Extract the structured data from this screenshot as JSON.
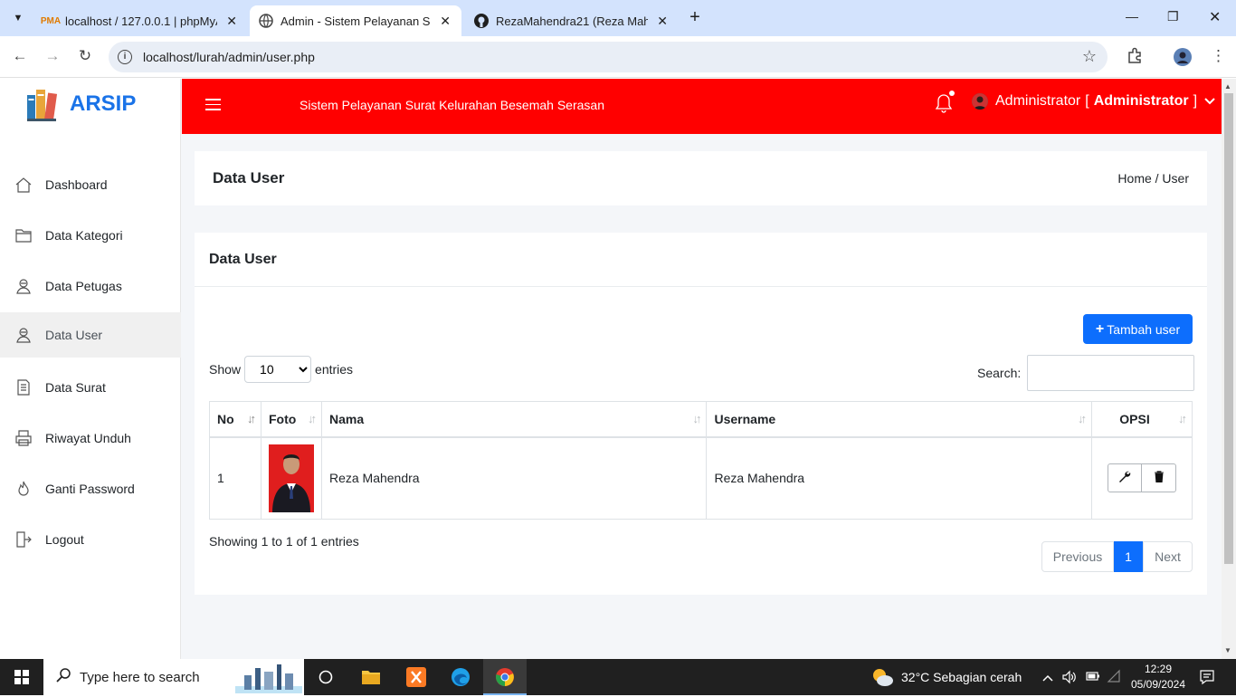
{
  "browser": {
    "tabs": [
      {
        "title": "localhost / 127.0.0.1 | phpMyAdmin",
        "favicon": "phpmyadmin-icon"
      },
      {
        "title": "Admin - Sistem Pelayanan Surat",
        "favicon": "globe-icon"
      },
      {
        "title": "RezaMahendra21 (Reza Mahendra)",
        "favicon": "github-icon"
      }
    ],
    "url": "localhost/lurah/admin/user.php"
  },
  "sidebar": {
    "brand": "ARSIP",
    "items": [
      {
        "label": "Dashboard",
        "icon": "home-icon"
      },
      {
        "label": "Data Kategori",
        "icon": "folder-icon"
      },
      {
        "label": "Data Petugas",
        "icon": "user-icon"
      },
      {
        "label": "Data User",
        "icon": "user-icon",
        "active": true
      },
      {
        "label": "Data Surat",
        "icon": "document-icon"
      },
      {
        "label": "Riwayat Unduh",
        "icon": "printer-icon"
      },
      {
        "label": "Ganti Password",
        "icon": "fire-icon"
      },
      {
        "label": "Logout",
        "icon": "logout-icon"
      }
    ]
  },
  "topnav": {
    "app_name": "Sistem Pelayanan Surat Kelurahan Besemah Serasan",
    "user_name": "Administrator",
    "user_role": "Administrator",
    "color": "#ff0000"
  },
  "page_header": {
    "title": "Data User",
    "breadcrumb": "Home / User"
  },
  "card": {
    "title": "Data User",
    "add_button": "Tambah user",
    "show_label": "Show",
    "entries_label": "entries",
    "page_length": "10",
    "search_label": "Search:",
    "columns": [
      "No",
      "Foto",
      "Nama",
      "Username",
      "OPSI"
    ],
    "rows": [
      {
        "no": "1",
        "nama": "Reza Mahendra",
        "username": "Reza Mahendra"
      }
    ],
    "info": "Showing 1 to 1 of 1 entries",
    "pager": {
      "prev": "Previous",
      "current": "1",
      "next": "Next"
    }
  },
  "taskbar": {
    "search_placeholder": "Type here to search",
    "weather": "32°C  Sebagian cerah",
    "time": "12:29",
    "date": "05/09/2024"
  }
}
